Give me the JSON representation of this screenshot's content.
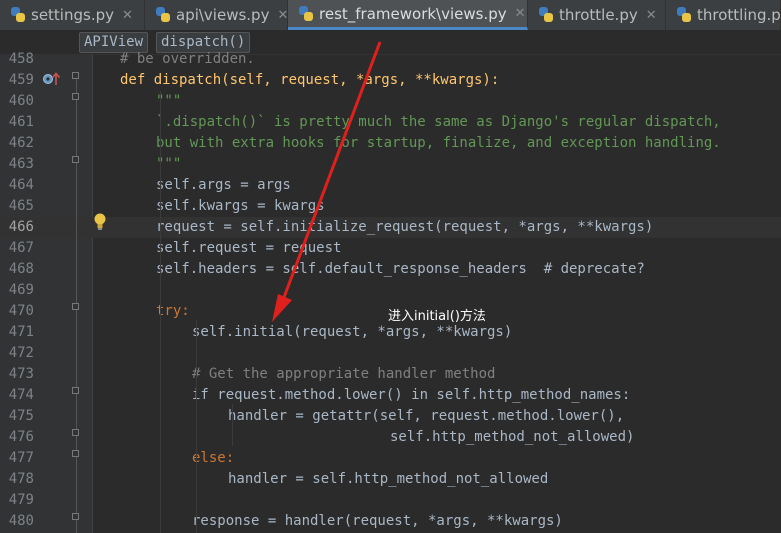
{
  "tabs": [
    {
      "label": "settings.py",
      "active": false
    },
    {
      "label": "api\\views.py",
      "active": false
    },
    {
      "label": "rest_framework\\views.py",
      "active": true
    },
    {
      "label": "throttle.py",
      "active": false
    },
    {
      "label": "throttling.py",
      "active": false
    }
  ],
  "breadcrumbs": [
    "APIView",
    "dispatch()"
  ],
  "lines": [
    {
      "num": "458",
      "text": "# be overridden.",
      "cls": "c-comment"
    },
    {
      "num": "459",
      "text": "def dispatch(self, request, *args, **kwargs):",
      "cls": "c-def-name"
    },
    {
      "num": "460",
      "text": "\"\"\"",
      "cls": "c-doc"
    },
    {
      "num": "461",
      "text": "`.dispatch()` is pretty much the same as Django's regular dispatch,",
      "cls": "c-doc"
    },
    {
      "num": "462",
      "text": "but with extra hooks for startup, finalize, and exception handling.",
      "cls": "c-doc"
    },
    {
      "num": "463",
      "text": "\"\"\"",
      "cls": "c-doc"
    },
    {
      "num": "464",
      "text": "self.args = args",
      "cls": "c-plain"
    },
    {
      "num": "465",
      "text": "self.kwargs = kwargs",
      "cls": "c-plain"
    },
    {
      "num": "466",
      "text": "request = self.initialize_request(request, *args, **kwargs)",
      "cls": "c-plain"
    },
    {
      "num": "467",
      "text": "self.request = request",
      "cls": "c-plain"
    },
    {
      "num": "468",
      "text": "self.headers = self.default_response_headers  # deprecate?",
      "cls": "c-plain"
    },
    {
      "num": "469",
      "text": "",
      "cls": "c-plain"
    },
    {
      "num": "470",
      "text": "try:",
      "cls": "c-kw"
    },
    {
      "num": "471",
      "text": "self.initial(request, *args, **kwargs)",
      "cls": "c-plain"
    },
    {
      "num": "472",
      "text": "",
      "cls": "c-plain"
    },
    {
      "num": "473",
      "text": "# Get the appropriate handler method",
      "cls": "c-comment"
    },
    {
      "num": "474",
      "text": "if request.method.lower() in self.http_method_names:",
      "cls": "c-plain"
    },
    {
      "num": "475",
      "text": "handler = getattr(self, request.method.lower(),",
      "cls": "c-plain"
    },
    {
      "num": "476",
      "text": "self.http_method_not_allowed)",
      "cls": "c-plain"
    },
    {
      "num": "477",
      "text": "else:",
      "cls": "c-kw"
    },
    {
      "num": "478",
      "text": "handler = self.http_method_not_allowed",
      "cls": "c-plain"
    },
    {
      "num": "479",
      "text": "",
      "cls": "c-plain"
    },
    {
      "num": "480",
      "text": "response = handler(request, *args, **kwargs)",
      "cls": "c-plain"
    }
  ],
  "annotation": "进入initial()方法",
  "colors": {
    "arrow": "#e0201c",
    "accent": "#4a88c7"
  },
  "icons": [
    "python-file-icon",
    "close-icon",
    "override-method-icon",
    "lightbulb-icon"
  ]
}
